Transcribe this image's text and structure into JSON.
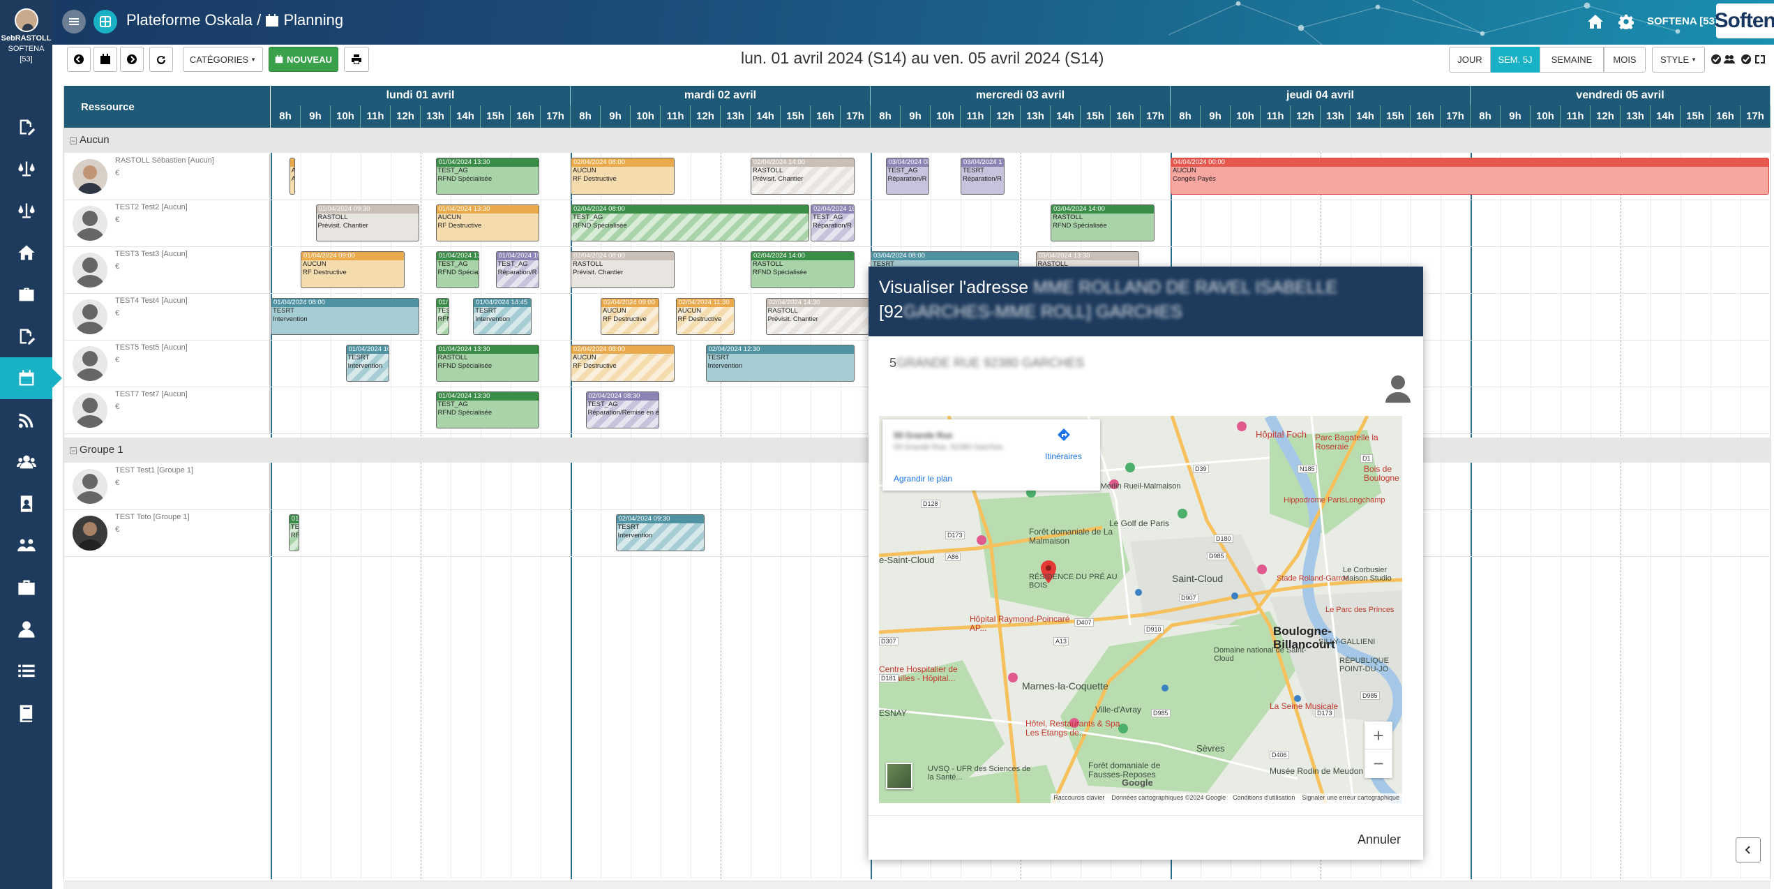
{
  "user": {
    "name": "SebRASTOLL",
    "company": "SOFTENA",
    "id": "[53]"
  },
  "topbar": {
    "title": "Plateforme Oskala /",
    "section": "Planning",
    "company": "SOFTENA [53]",
    "logo": "Softena"
  },
  "toolbar": {
    "categories": "CATÉGORIES",
    "nouveau": "NOUVEAU"
  },
  "period": "lun. 01 avril 2024 (S14) au ven. 05 avril 2024 (S14)",
  "views": {
    "jour": "JOUR",
    "sem5j": "SEM. 5J",
    "semaine": "SEMAINE",
    "mois": "MOIS",
    "style": "STYLE"
  },
  "grid": {
    "resource_header": "Ressource",
    "days": [
      "lundi 01 avril",
      "mardi 02 avril",
      "mercredi 03 avril",
      "jeudi 04 avril",
      "vendredi 05 avril"
    ],
    "hours": [
      "8h",
      "9h",
      "10h",
      "11h",
      "12h",
      "13h",
      "14h",
      "15h",
      "16h",
      "17h"
    ],
    "groups": [
      "Aucun",
      "Groupe 1"
    ],
    "resources": [
      {
        "name": "RASTOLL Sébastien [Aucun]",
        "euro": "€"
      },
      {
        "name": "TEST2 Test2 [Aucun]",
        "euro": "€"
      },
      {
        "name": "TEST3 Test3 [Aucun]",
        "euro": "€"
      },
      {
        "name": "TEST4 Test4 [Aucun]",
        "euro": "€"
      },
      {
        "name": "TEST5 Test5 [Aucun]",
        "euro": "€"
      },
      {
        "name": "TEST7 Test7 [Aucun]",
        "euro": "€"
      },
      {
        "name": "TEST Test1 [Groupe 1]",
        "euro": "€"
      },
      {
        "name": "TEST Toto [Groupe 1]",
        "euro": "€"
      }
    ]
  },
  "events": [
    {
      "row": 0,
      "start": 0.62,
      "dur": 0.22,
      "color": "orange",
      "striped": false,
      "h": "",
      "l1": "A",
      "l2": "A"
    },
    {
      "row": 0,
      "start": 5.5,
      "dur": 3.5,
      "color": "green",
      "striped": false,
      "h": "01/04/2024 13:30",
      "l1": "TEST_AG",
      "l2": "RFND Spécialisée"
    },
    {
      "row": 0,
      "start": 10,
      "dur": 3.5,
      "color": "orange",
      "striped": false,
      "h": "02/04/2024 08:00",
      "l1": "AUCUN",
      "l2": "RF Destructive"
    },
    {
      "row": 0,
      "start": 16,
      "dur": 3.5,
      "color": "grey",
      "striped": true,
      "h": "02/04/2024 14:00",
      "l1": "RASTOLL",
      "l2": "Prévisit. Chantier"
    },
    {
      "row": 0,
      "start": 20.5,
      "dur": 1.5,
      "color": "lav",
      "striped": false,
      "h": "03/04/2024 08",
      "l1": "TEST_AG",
      "l2": "Réparation/R"
    },
    {
      "row": 0,
      "start": 23,
      "dur": 1.5,
      "color": "lav",
      "striped": false,
      "h": "03/04/2024 1",
      "l1": "TESRT",
      "l2": "Réparation/R"
    },
    {
      "row": 0,
      "start": 30,
      "dur": 20,
      "color": "red",
      "striped": false,
      "h": "04/04/2024 00:00",
      "l1": "AUCUN",
      "l2": "Congés Payés"
    },
    {
      "row": 1,
      "start": 1.5,
      "dur": 3.5,
      "color": "grey",
      "striped": false,
      "h": "01/04/2024 09:30",
      "l1": "RASTOLL",
      "l2": "Prévisit. Chantier"
    },
    {
      "row": 1,
      "start": 5.5,
      "dur": 3.5,
      "color": "orange",
      "striped": false,
      "h": "01/04/2024 13:30",
      "l1": "AUCUN",
      "l2": "RF Destructive"
    },
    {
      "row": 1,
      "start": 10,
      "dur": 8,
      "color": "green",
      "striped": true,
      "h": "02/04/2024 08:00",
      "l1": "TEST_AG",
      "l2": "RFND Spécialisée"
    },
    {
      "row": 1,
      "start": 18,
      "dur": 1.5,
      "color": "lav",
      "striped": true,
      "h": "02/04/2024 16",
      "l1": "TEST_AG",
      "l2": "Réparation/R"
    },
    {
      "row": 1,
      "start": 26,
      "dur": 3.5,
      "color": "green",
      "striped": false,
      "h": "03/04/2024 14:00",
      "l1": "RASTOLL",
      "l2": "RFND Spécialisée"
    },
    {
      "row": 2,
      "start": 1,
      "dur": 3.5,
      "color": "orange",
      "striped": false,
      "h": "01/04/2024 09:00",
      "l1": "AUCUN",
      "l2": "RF Destructive"
    },
    {
      "row": 2,
      "start": 5.5,
      "dur": 1.5,
      "color": "green",
      "striped": false,
      "h": "01/04/2024 13",
      "l1": "TEST_AG",
      "l2": "RFND Spécialisée"
    },
    {
      "row": 2,
      "start": 7.5,
      "dur": 1.5,
      "color": "lav",
      "striped": true,
      "h": "01/04/2024 15",
      "l1": "TEST_AG",
      "l2": "Réparation/R"
    },
    {
      "row": 2,
      "start": 10,
      "dur": 3.5,
      "color": "grey",
      "striped": false,
      "h": "02/04/2024 08:00",
      "l1": "RASTOLL",
      "l2": "Prévisit. Chantier"
    },
    {
      "row": 2,
      "start": 16,
      "dur": 3.5,
      "color": "green",
      "striped": false,
      "h": "02/04/2024 14:00",
      "l1": "RASTOLL",
      "l2": "RFND Spécialisée"
    },
    {
      "row": 2,
      "start": 20,
      "dur": 5,
      "color": "teal",
      "striped": false,
      "h": "03/04/2024 08:00",
      "l1": "TESRT",
      "l2": ""
    },
    {
      "row": 2,
      "start": 25.5,
      "dur": 3.5,
      "color": "grey",
      "striped": false,
      "h": "03/04/2024 13:30",
      "l1": "RASTOLL",
      "l2": ""
    },
    {
      "row": 3,
      "start": 0,
      "dur": 5,
      "color": "teal",
      "striped": false,
      "h": "01/04/2024 08:00",
      "l1": "TESRT",
      "l2": "Intervention"
    },
    {
      "row": 3,
      "start": 5.5,
      "dur": 0.5,
      "color": "green",
      "striped": true,
      "h": "01/",
      "l1": "TES",
      "l2": "RFN"
    },
    {
      "row": 3,
      "start": 6.75,
      "dur": 2,
      "color": "teal",
      "striped": true,
      "h": "01/04/2024 14:45",
      "l1": "TESRT",
      "l2": "Intervention"
    },
    {
      "row": 3,
      "start": 11,
      "dur": 2,
      "color": "orange",
      "striped": true,
      "h": "02/04/2024 09:00",
      "l1": "AUCUN",
      "l2": "RF Destructive"
    },
    {
      "row": 3,
      "start": 13.5,
      "dur": 2,
      "color": "orange",
      "striped": true,
      "h": "02/04/2024 11:30",
      "l1": "AUCUN",
      "l2": "RF Destructive"
    },
    {
      "row": 3,
      "start": 16.5,
      "dur": 3.5,
      "color": "grey",
      "striped": true,
      "h": "02/04/2024 14:30",
      "l1": "RASTOLL",
      "l2": "Prévisit. Chantier"
    },
    {
      "row": 4,
      "start": 2.5,
      "dur": 1.5,
      "color": "teal",
      "striped": true,
      "h": "01/04/2024 10",
      "l1": "TESRT",
      "l2": "Intervention"
    },
    {
      "row": 4,
      "start": 5.5,
      "dur": 3.5,
      "color": "green",
      "striped": false,
      "h": "01/04/2024 13:30",
      "l1": "RASTOLL",
      "l2": "RFND Spécialisée"
    },
    {
      "row": 4,
      "start": 10,
      "dur": 3.5,
      "color": "orange",
      "striped": true,
      "h": "02/04/2024 08:00",
      "l1": "AUCUN",
      "l2": "RF Destructive"
    },
    {
      "row": 4,
      "start": 14.5,
      "dur": 5,
      "color": "teal",
      "striped": false,
      "h": "02/04/2024 12:30",
      "l1": "TESRT",
      "l2": "Intervention"
    },
    {
      "row": 5,
      "start": 5.5,
      "dur": 3.5,
      "color": "green",
      "striped": false,
      "h": "01/04/2024 13:30",
      "l1": "TEST_AG",
      "l2": "RFND Spécialisée"
    },
    {
      "row": 5,
      "start": 10.5,
      "dur": 2.5,
      "color": "lav",
      "striped": true,
      "h": "02/04/2024 08:30",
      "l1": "TEST_AG",
      "l2": "Réparation/Remise en é"
    },
    {
      "row": 7,
      "start": 0.6,
      "dur": 0.4,
      "color": "green",
      "striped": true,
      "h": "01/",
      "l1": "TE",
      "l2": "RF"
    },
    {
      "row": 7,
      "start": 11.5,
      "dur": 3,
      "color": "teal",
      "striped": true,
      "h": "02/04/2024 09:30",
      "l1": "TESRT",
      "l2": "Intervention"
    }
  ],
  "modal": {
    "title_visible": "Visualiser l'adresse",
    "title_blurred": "MME ROLLAND DE RAVEL ISABELLE",
    "title_line2_visible": "[92",
    "title_line2_blurred": "GARCHES-MME ROLL] GARCHES",
    "address_visible": "5",
    "address_blurred": "GRANDE RUE 92380 GARCHES",
    "cancel": "Annuler"
  },
  "map": {
    "card_title_blurred": "59 Grande Rue",
    "card_sub_blurred": "59 Grande Rue, 92380 Garches",
    "itineraires": "Itinéraires",
    "agrandir": "Agrandir le plan",
    "labels": [
      "Hôpital Foch",
      "Parc Bagatelle la Roseraie",
      "Bois de Boulogne",
      "Hippodrome ParisLongchamp",
      "Le Golf de Paris",
      "Forêt domaniale de La Malmaison",
      "RÉSIDENCE DU PRÉ AU BOIS",
      "Saint-Cloud",
      "Boulogne-Billancourt",
      "Stade Roland-Garros",
      "Le Parc des Princes",
      "Hôpital Raymond-Poincaré AP...",
      "Marnes-la-Coquette",
      "Ville-d'Avray",
      "Centre Hospitalier de Versailles - Hôpital...",
      "Hôtel, Restaurants & Spa Les Etangs de...",
      "La Seine Musicale",
      "Sèvres",
      "Musée Rodin de Meudon",
      "Forêt domaniale de Fausses-Reposes",
      "UVSQ - UFR des Sciences de la Santé...",
      "Domaine national de Saint-Cloud",
      "SILLY-GALLIENI",
      "RÉPUBLIQUE POINT-DU-JO",
      "Le Corbusier Maison Studio",
      "Roy Merlin Rueil-Malmaison",
      "e-Saint-Cloud",
      "ESNAY"
    ],
    "roads": [
      "D39",
      "N185",
      "D1",
      "D128",
      "D173",
      "A86",
      "D180",
      "D985",
      "D907",
      "D910",
      "D407",
      "D307",
      "A13",
      "D406",
      "D985",
      "D173",
      "D181",
      "D985"
    ],
    "footer": [
      "Raccourcis clavier",
      "Données cartographiques ©2024 Google",
      "Conditions d'utilisation",
      "Signaler une erreur cartographique"
    ],
    "google": "Google",
    "zoom_in": "+",
    "zoom_out": "−"
  }
}
